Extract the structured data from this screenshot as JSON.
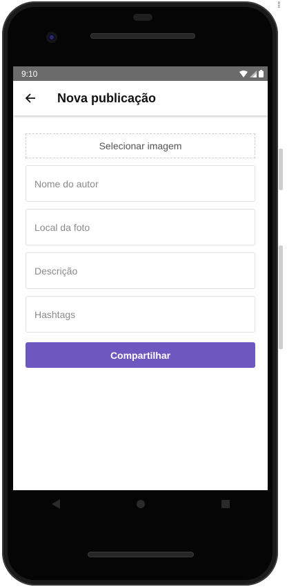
{
  "status_bar": {
    "time": "9:10"
  },
  "app_bar": {
    "title": "Nova publicação"
  },
  "form": {
    "select_image_label": "Selecionar imagem",
    "author_placeholder": "Nome do autor",
    "location_placeholder": "Local da foto",
    "description_placeholder": "Descrição",
    "hashtags_placeholder": "Hashtags",
    "share_label": "Compartilhar"
  },
  "colors": {
    "accent": "#6e58bf",
    "status_bar": "#6b6b6b"
  },
  "icons": {
    "back": "arrow-left-icon",
    "wifi": "wifi-icon",
    "signal": "signal-icon",
    "battery": "battery-icon",
    "nav_back": "triangle-back-icon",
    "nav_home": "circle-home-icon",
    "nav_recents": "square-recents-icon"
  }
}
